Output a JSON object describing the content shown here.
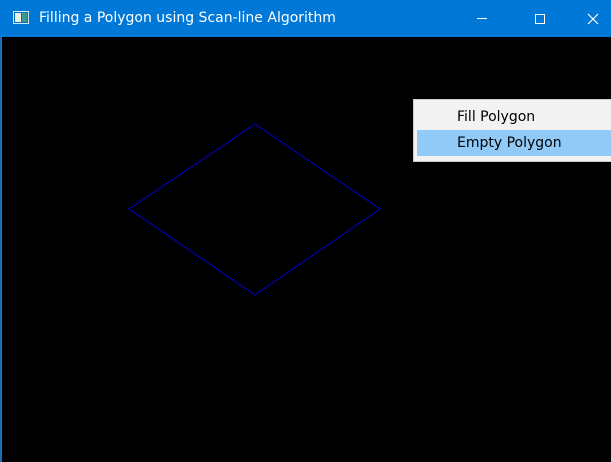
{
  "window": {
    "title": "Filling a Polygon using Scan-line Algorithm",
    "titlebar_color": "#0078d7",
    "canvas_color": "#000000"
  },
  "titlebar_buttons": {
    "minimize_icon": "minimize-icon",
    "maximize_icon": "maximize-icon",
    "close_icon": "close-icon"
  },
  "polygon": {
    "shape": "diamond",
    "stroke_color": "#0000aa",
    "filled": false
  },
  "context_menu": {
    "items": [
      {
        "label": "Fill Polygon",
        "highlighted": false
      },
      {
        "label": "Empty Polygon",
        "highlighted": true
      }
    ],
    "highlight_color": "#91c9f7"
  }
}
